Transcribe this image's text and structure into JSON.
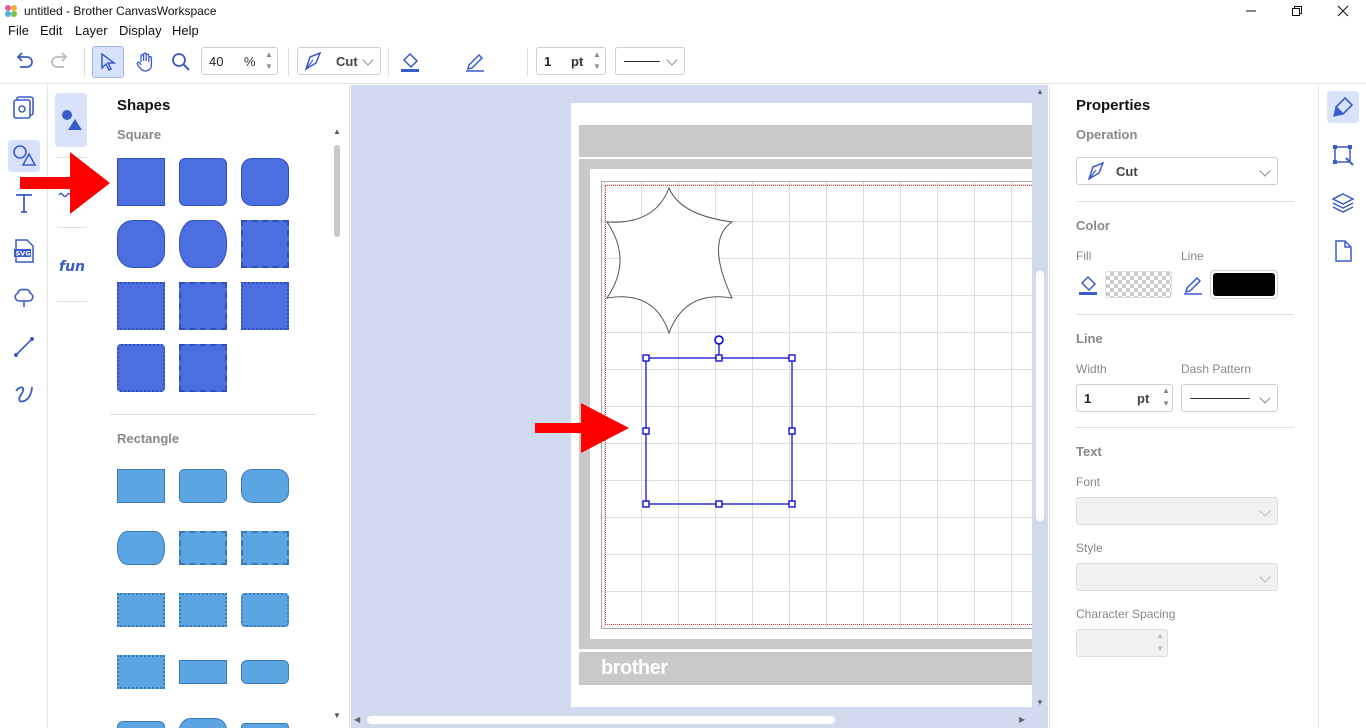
{
  "window": {
    "title": "untitled - Brother CanvasWorkspace",
    "controls": [
      "minimize",
      "restore",
      "close"
    ]
  },
  "menu": {
    "items": [
      "File",
      "Edit",
      "Layer",
      "Display",
      "Help"
    ]
  },
  "toolbar": {
    "zoom_value": "40",
    "zoom_unit": "%",
    "operation_label": "Cut",
    "line_width_value": "1",
    "line_width_unit": "pt",
    "line_color": "#000000",
    "icons": [
      "undo-icon",
      "redo-icon",
      "select-arrow-icon",
      "hand-pan-icon",
      "zoom-magnifier-icon",
      "cut-pen-icon",
      "fill-bucket-icon",
      "line-pen-icon"
    ]
  },
  "left_rail": {
    "icons": [
      "project-icon",
      "shapes-icon",
      "text-icon",
      "svg-import-icon",
      "clipart-icon",
      "line-draw-icon",
      "freehand-icon"
    ]
  },
  "sub_rail": {
    "icons": [
      "basic-shapes-icon",
      "border-shapes-icon",
      "fun-shapes-icon"
    ],
    "fun_label": "fun"
  },
  "shapes_panel": {
    "title": "Shapes",
    "sections": [
      {
        "name": "Square",
        "count": 11
      },
      {
        "name": "Rectangle",
        "count": 12
      }
    ],
    "square_color": "#4b6fe0",
    "rectangle_color": "#5ca5e3"
  },
  "canvas": {
    "mat_brand": "brother",
    "annotation_arrow_color": "#ff0000",
    "selection_color": "#0000cc"
  },
  "properties": {
    "title": "Properties",
    "operation_label": "Operation",
    "operation_value": "Cut",
    "color_label": "Color",
    "fill_label": "Fill",
    "line_label": "Line",
    "line_color": "#000000",
    "line_section_label": "Line",
    "width_label": "Width",
    "width_value": "1",
    "width_unit": "pt",
    "dash_pattern_label": "Dash Pattern",
    "text_section_label": "Text",
    "font_label": "Font",
    "style_label": "Style",
    "char_spacing_label": "Character Spacing"
  },
  "right_rail": {
    "icons": [
      "properties-brush-icon",
      "transform-icon",
      "layers-icon",
      "page-icon"
    ]
  }
}
